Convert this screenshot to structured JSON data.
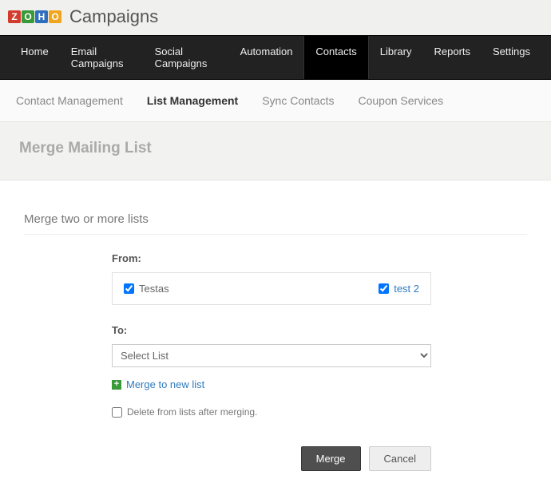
{
  "brand": {
    "title": "Campaigns"
  },
  "nav": {
    "items": [
      "Home",
      "Email Campaigns",
      "Social Campaigns",
      "Automation",
      "Contacts",
      "Library",
      "Reports",
      "Settings"
    ],
    "activeIndex": 4
  },
  "subnav": {
    "items": [
      "Contact Management",
      "List Management",
      "Sync Contacts",
      "Coupon Services"
    ],
    "activeIndex": 1
  },
  "page": {
    "title": "Merge Mailing List",
    "section": "Merge two or more lists"
  },
  "form": {
    "from_label": "From:",
    "from_items": [
      {
        "label": "Testas",
        "checked": true,
        "link": false
      },
      {
        "label": "test 2",
        "checked": true,
        "link": true
      }
    ],
    "to_label": "To:",
    "to_select_placeholder": "Select List",
    "merge_new_label": "Merge to new list",
    "delete_label": "Delete from lists after merging.",
    "delete_checked": false
  },
  "buttons": {
    "primary": "Merge",
    "secondary": "Cancel"
  }
}
